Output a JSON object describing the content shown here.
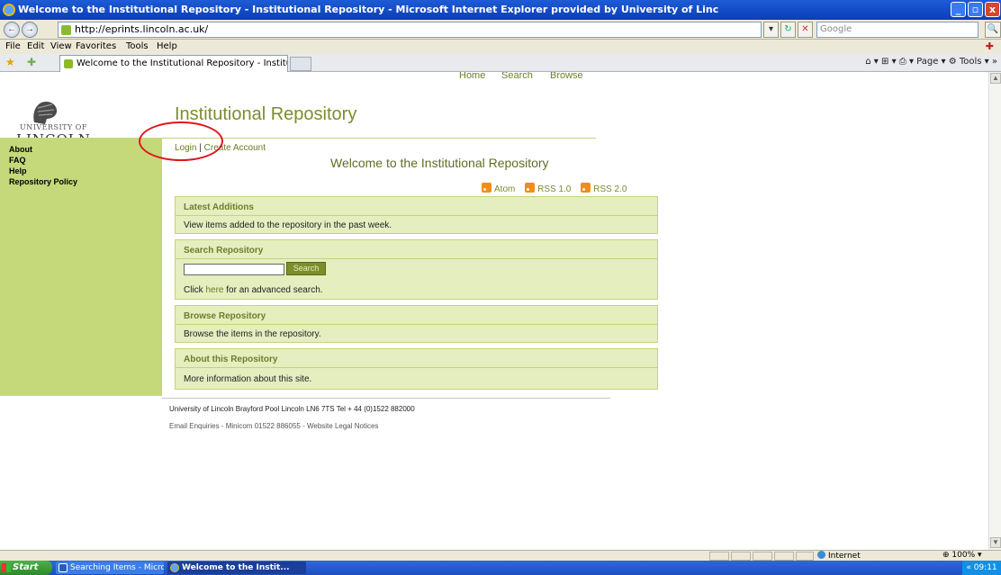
{
  "window": {
    "title": "Welcome to the Institutional Repository - Institutional Repository - Microsoft Internet Explorer provided by University of Linc",
    "minimize": "_",
    "maximize": "▫",
    "close": "x"
  },
  "address_bar": {
    "back_label": "←",
    "forward_label": "→",
    "url": "http://eprints.lincoln.ac.uk/",
    "go_label": "▾",
    "refresh_label": "↻",
    "stop_label": "✕",
    "search_placeholder": "Google",
    "search_icon": "🔍"
  },
  "menu": {
    "items": [
      "File",
      "Edit",
      "View",
      "Favorites",
      "Tools",
      "Help"
    ],
    "toolbox": "✚"
  },
  "tabs": {
    "favorites_star": "★",
    "add_favorites": "✚",
    "active_tab_title": "Welcome to the Institutional Repository - Institutional...",
    "command_bar": "⌂ ▾  ⊞ ▾  ⎙ ▾  Page ▾  ⚙ Tools ▾  »"
  },
  "page": {
    "top_nav": [
      "Home",
      "Search",
      "Browse"
    ],
    "logo": {
      "line1": "UNIVERSITY OF",
      "line2": "LINCOLN"
    },
    "repository_title": "Institutional Repository",
    "sidebar": [
      "About",
      "FAQ",
      "Help",
      "Repository Policy"
    ],
    "login_label": "Login",
    "separator": "|",
    "create_account_label": "Create Account",
    "welcome_heading": "Welcome to the Institutional Repository",
    "feeds": [
      "Atom",
      "RSS 1.0",
      "RSS 2.0"
    ],
    "boxes": {
      "latest": {
        "title": "Latest Additions",
        "text": "View items added to the repository in the past week."
      },
      "search": {
        "title": "Search Repository",
        "button_label": "Search",
        "text_before": "Click ",
        "link": "here",
        "text_after": " for an advanced search."
      },
      "browse": {
        "title": "Browse Repository",
        "text": "Browse the items in the repository."
      },
      "about": {
        "title": "About this Repository",
        "text": "More information about this site."
      }
    },
    "footer_address": "University of Lincoln Brayford Pool Lincoln LN6 7TS Tel + 44 (0)1522 882000",
    "footer_links": "Email Enquiries - Minicom 01522 886055 - Website Legal Notices"
  },
  "status_bar": {
    "zone": "Internet",
    "zoom": "⊕ 100%  ▾"
  },
  "taskbar": {
    "start": "Start",
    "tasks": [
      "Searching Items - Micros...",
      "Welcome to the Instit..."
    ],
    "clock": "« 09:11"
  }
}
